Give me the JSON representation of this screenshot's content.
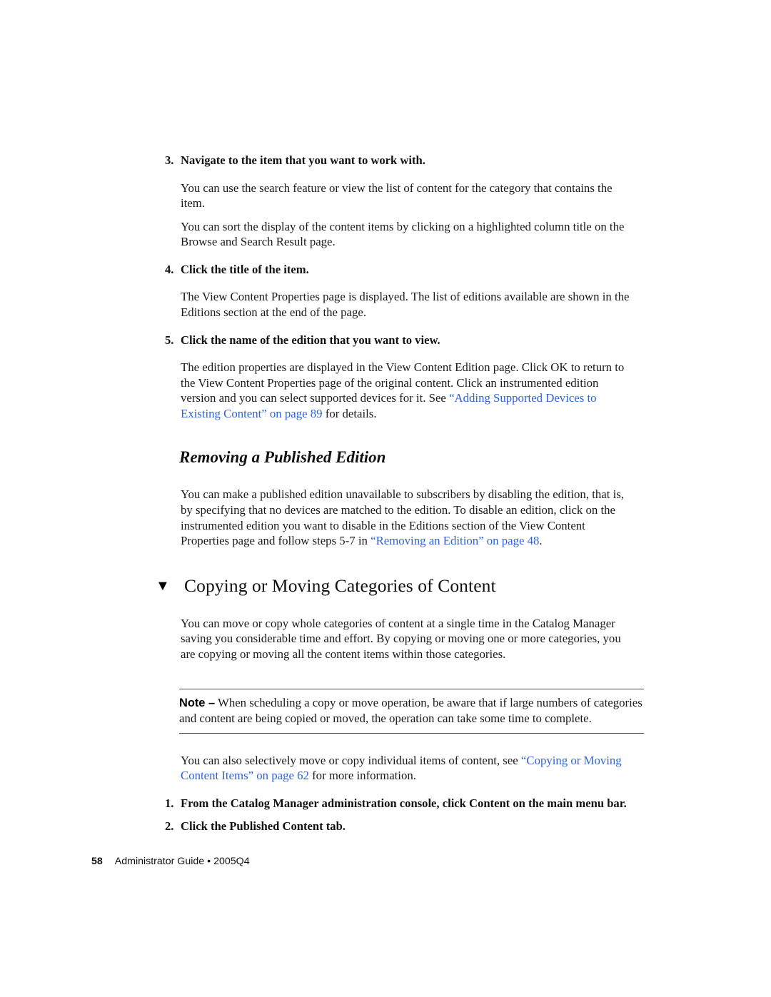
{
  "page": {
    "number": "58",
    "footer_title": "Administrator Guide",
    "footer_separator": "•",
    "footer_edition": "2005Q4"
  },
  "colors": {
    "link": "#2f63d4",
    "text": "#1a1a1a",
    "rule": "#4a4a4a"
  },
  "steps_top": [
    {
      "num": "3.",
      "title": "Navigate to the item that you want to work with.",
      "paragraphs": [
        "You can use the search feature or view the list of content for the category that contains the item.",
        "You can sort the display of the content items by clicking on a highlighted column title on the Browse and Search Result page."
      ]
    },
    {
      "num": "4.",
      "title": "Click the title of the item.",
      "paragraphs": [
        "The View Content Properties page is displayed. The list of editions available are shown in the Editions section at the end of the page."
      ]
    },
    {
      "num": "5.",
      "title": "Click the name of the edition that you want to view.",
      "paragraphs": []
    }
  ],
  "step5_body": {
    "lead": "The edition properties are displayed in the View Content Edition page. Click OK to return to the View Content Properties page of the original content. Click an instrumented edition version and you can select supported devices for it. See ",
    "link": "“Adding Supported Devices to Existing Content” on page 89",
    "tail": " for details."
  },
  "subsection": {
    "heading": "Removing a Published Edition",
    "body_lead": "You can make a published edition unavailable to subscribers by disabling the edition, that is, by specifying that no devices are matched to the edition. To disable an edition, click on the instrumented edition you want to disable in the Editions section of the View Content Properties page and follow steps 5-7 in ",
    "body_link": "“Removing an Edition” on page 48",
    "body_tail": "."
  },
  "section": {
    "bullet": "▼",
    "heading": "Copying or Moving Categories of Content",
    "intro": "You can move or copy whole categories of content at a single time in the Catalog Manager saving you considerable time and effort. By copying or moving one or more categories, you are copying or moving all the content items within those categories."
  },
  "note": {
    "label": "Note –",
    "text": " When scheduling a copy or move operation, be aware that if large numbers of categories and content are being copied or moved, the operation can take some time to complete."
  },
  "after_note": {
    "lead": "You can also selectively move or copy individual items of content, see ",
    "link": "“Copying or Moving Content Items” on page 62",
    "tail": " for more information."
  },
  "steps_bottom": [
    {
      "num": "1.",
      "title": "From the Catalog Manager administration console, click Content on the main menu bar."
    },
    {
      "num": "2.",
      "title": "Click the Published Content tab."
    }
  ]
}
